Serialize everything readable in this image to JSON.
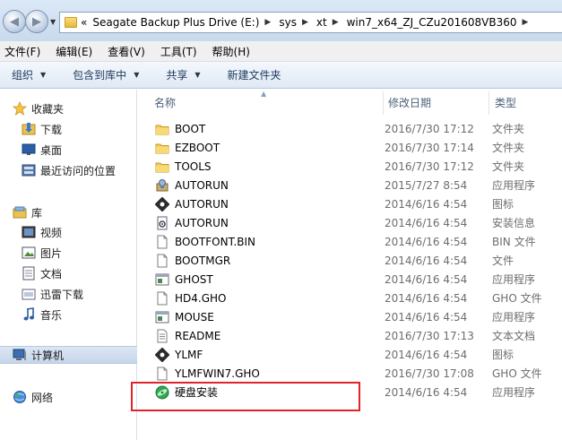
{
  "address": {
    "prefix": "«",
    "crumbs": [
      "Seagate Backup Plus Drive (E:)",
      "sys",
      "xt",
      "win7_x64_ZJ_CZu201608VB360"
    ]
  },
  "menu": [
    "文件(F)",
    "编辑(E)",
    "查看(V)",
    "工具(T)",
    "帮助(H)"
  ],
  "toolbar": [
    "组织",
    "包含到库中",
    "共享",
    "新建文件夹"
  ],
  "nav": {
    "favorites": "收藏夹",
    "downloads": "下载",
    "desktop": "桌面",
    "recent": "最近访问的位置",
    "libraries": "库",
    "videos": "视频",
    "pictures": "图片",
    "documents": "文档",
    "xunlei": "迅雷下载",
    "music": "音乐",
    "computer": "计算机",
    "network": "网络"
  },
  "columns": {
    "name": "名称",
    "date": "修改日期",
    "type": "类型"
  },
  "files": [
    {
      "name": "BOOT",
      "date": "2016/7/30 17:12",
      "type": "文件夹",
      "icon": "folder-icon"
    },
    {
      "name": "EZBOOT",
      "date": "2016/7/30 17:14",
      "type": "文件夹",
      "icon": "folder-icon"
    },
    {
      "name": "TOOLS",
      "date": "2016/7/30 17:12",
      "type": "文件夹",
      "icon": "folder-icon"
    },
    {
      "name": "AUTORUN",
      "date": "2015/7/27 8:54",
      "type": "应用程序",
      "icon": "installer-icon"
    },
    {
      "name": "AUTORUN",
      "date": "2014/6/16 4:54",
      "type": "图标",
      "icon": "ico-file-icon"
    },
    {
      "name": "AUTORUN",
      "date": "2014/6/16 4:54",
      "type": "安装信息",
      "icon": "gear-file-icon"
    },
    {
      "name": "BOOTFONT.BIN",
      "date": "2014/6/16 4:54",
      "type": "BIN 文件",
      "icon": "blank-file-icon"
    },
    {
      "name": "BOOTMGR",
      "date": "2014/6/16 4:54",
      "type": "文件",
      "icon": "blank-file-icon"
    },
    {
      "name": "GHOST",
      "date": "2014/6/16 4:54",
      "type": "应用程序",
      "icon": "app-window-icon"
    },
    {
      "name": "HD4.GHO",
      "date": "2014/6/16 4:54",
      "type": "GHO 文件",
      "icon": "blank-file-icon"
    },
    {
      "name": "MOUSE",
      "date": "2014/6/16 4:54",
      "type": "应用程序",
      "icon": "app-window-icon"
    },
    {
      "name": "README",
      "date": "2016/7/30 17:13",
      "type": "文本文档",
      "icon": "text-file-icon"
    },
    {
      "name": "YLMF",
      "date": "2014/6/16 4:54",
      "type": "图标",
      "icon": "ico-file-icon"
    },
    {
      "name": "YLMFWIN7.GHO",
      "date": "2016/7/30 17:08",
      "type": "GHO 文件",
      "icon": "blank-file-icon"
    },
    {
      "name": "硬盘安装",
      "date": "2014/6/16 4:54",
      "type": "应用程序",
      "icon": "green-disk-icon"
    }
  ],
  "colors": {
    "highlight": "#e0252a",
    "folder": "#e7b93d",
    "nav_selected": "#c6d6ea"
  }
}
